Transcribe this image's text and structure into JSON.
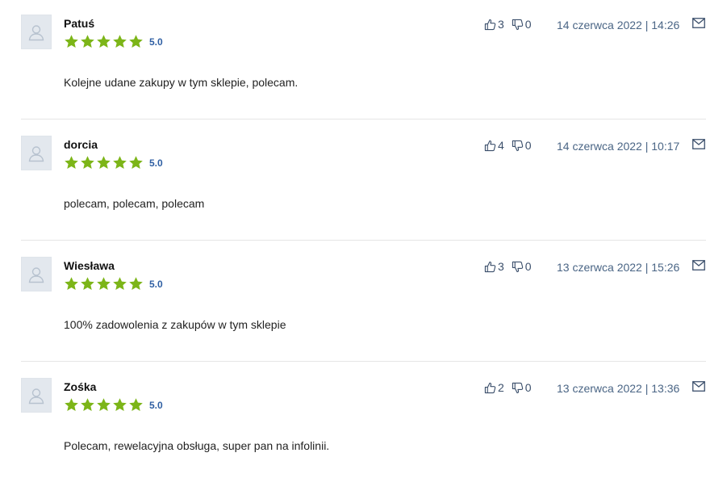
{
  "colors": {
    "star": "#7cb518",
    "rating_value": "#2f5fa3",
    "date": "#4a6585",
    "vote": "#3b4f6b",
    "avatar_bg": "#e3e8ee"
  },
  "icons": {
    "avatar": "user-silhouette-icon",
    "star": "star-icon",
    "thumbs_up": "thumbs-up-icon",
    "thumbs_down": "thumbs-down-icon",
    "mail": "envelope-icon"
  },
  "reviews": [
    {
      "author": "Patuś",
      "rating": "5.0",
      "stars": 5,
      "likes": "3",
      "dislikes": "0",
      "date": "14 czerwca 2022 | 14:26",
      "text": "Kolejne udane zakupy w tym sklepie, polecam."
    },
    {
      "author": "dorcia",
      "rating": "5.0",
      "stars": 5,
      "likes": "4",
      "dislikes": "0",
      "date": "14 czerwca 2022 | 10:17",
      "text": "polecam, polecam, polecam"
    },
    {
      "author": "Wiesława",
      "rating": "5.0",
      "stars": 5,
      "likes": "3",
      "dislikes": "0",
      "date": "13 czerwca 2022 | 15:26",
      "text": "100% zadowolenia z zakupów w tym sklepie"
    },
    {
      "author": "Zośka",
      "rating": "5.0",
      "stars": 5,
      "likes": "2",
      "dislikes": "0",
      "date": "13 czerwca 2022 | 13:36",
      "text": "Polecam, rewelacyjna obsługa, super pan na infolinii."
    }
  ]
}
